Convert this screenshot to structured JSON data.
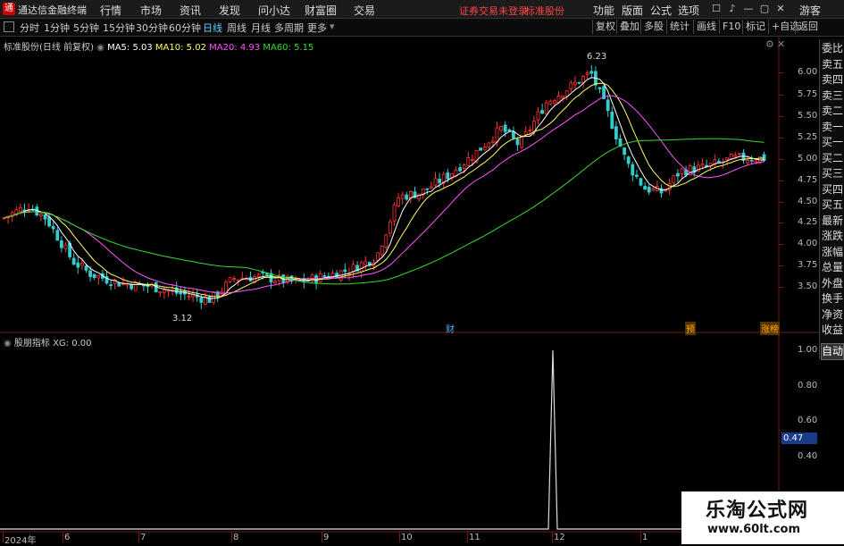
{
  "app": {
    "title": "通达信金融终端",
    "menu": [
      "行情",
      "市场",
      "资讯",
      "发现",
      "问小达",
      "财富圈",
      "交易"
    ],
    "notice": "证券交易未登录",
    "stock_short": "标准股份",
    "right_menu": [
      "功能",
      "版面",
      "公式",
      "选项"
    ],
    "user": "游客"
  },
  "toolbar": {
    "periods": [
      "分时",
      "1分钟",
      "5分钟",
      "15分钟",
      "30分钟",
      "60分钟",
      "日线",
      "周线",
      "月线",
      "多周期",
      "更多"
    ],
    "active_period": "日线",
    "actions": [
      "复权",
      "叠加",
      "多股",
      "统计",
      "画线",
      "F10",
      "标记",
      "+自选",
      "返回"
    ]
  },
  "main_chart": {
    "stock_label": "标准股份(日线 前复权)",
    "ma": [
      {
        "label": "MA5: 5.03",
        "color": "#ffffff"
      },
      {
        "label": "MA10: 5.02",
        "color": "#ffff66"
      },
      {
        "label": "MA20: 4.93",
        "color": "#ff55ff"
      },
      {
        "label": "MA60: 5.15",
        "color": "#33dd33"
      }
    ],
    "high_label": "6.23",
    "low_label": "3.12",
    "event_markers": [
      "财",
      "预",
      "涨榜"
    ],
    "y_ticks": [
      "6.00",
      "5.75",
      "5.50",
      "5.25",
      "5.00",
      "4.75",
      "4.50",
      "4.25",
      "4.00",
      "3.75",
      "3.50"
    ]
  },
  "indicator": {
    "label": "股朋指标 XG: 0.00",
    "y_ticks": [
      "1.00",
      "0.80",
      "0.60",
      "0.40"
    ],
    "cursor_value": "0.47"
  },
  "x_axis": [
    "2024年",
    "6",
    "7",
    "8",
    "9",
    "10",
    "11",
    "12",
    "1"
  ],
  "right_panel": [
    "委比",
    "卖五",
    "卖四",
    "卖三",
    "卖二",
    "卖一",
    "买一",
    "买二",
    "买三",
    "买四",
    "买五",
    "最新",
    "涨跌",
    "涨幅",
    "总量",
    "外盘",
    "换手",
    "净资",
    "收益",
    "自动"
  ],
  "watermark": {
    "line1": "乐淘公式网",
    "line2": "www.60lt.com"
  },
  "colors": {
    "up": "#ff3333",
    "down": "#33cccc",
    "accent": "#55aaff"
  }
}
